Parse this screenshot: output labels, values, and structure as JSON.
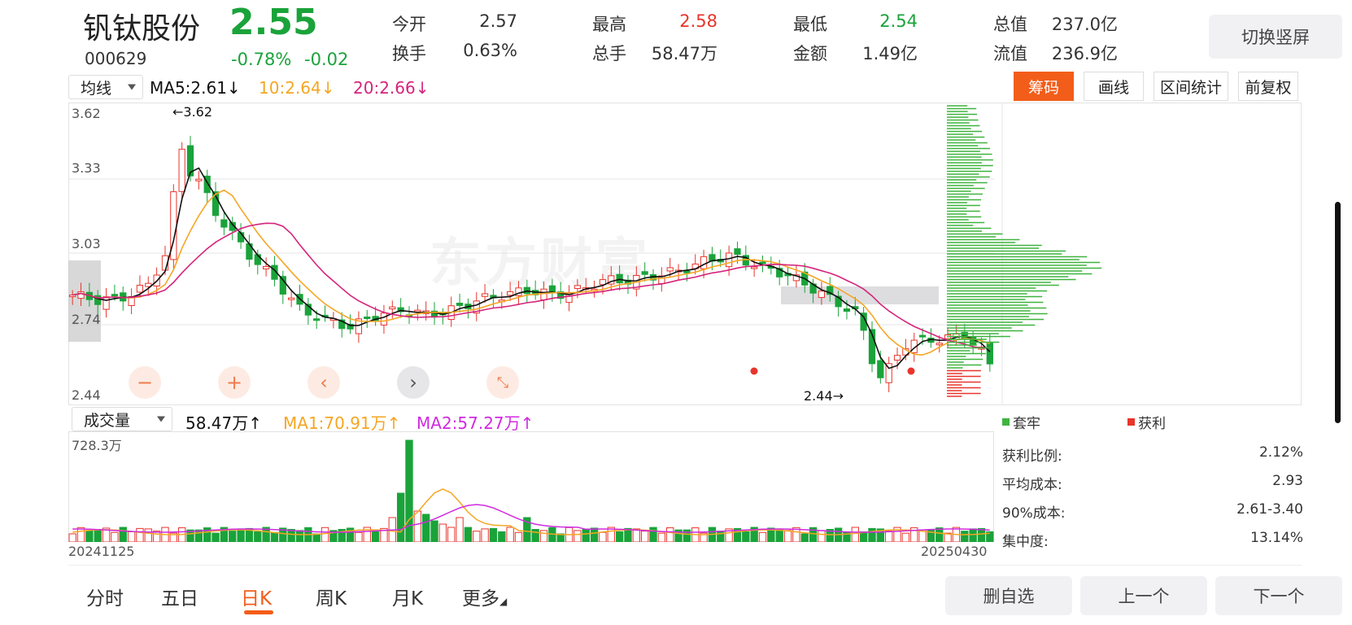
{
  "header": {
    "name": "钒钛股份",
    "code": "000629",
    "price": "2.55",
    "change_pct": "-0.78%",
    "change_abs": "-0.02",
    "quotes": [
      {
        "label": "今开",
        "value": "2.57",
        "color": "#333333"
      },
      {
        "label": "换手",
        "value": "0.63%",
        "color": "#333333"
      },
      {
        "label": "最高",
        "value": "2.58",
        "color": "#e8352c"
      },
      {
        "label": "总手",
        "value": "58.47万",
        "color": "#333333"
      },
      {
        "label": "最低",
        "value": "2.54",
        "color": "#1aa33a"
      },
      {
        "label": "金额",
        "value": "1.49亿",
        "color": "#333333"
      },
      {
        "label": "总值",
        "value": "237.0亿",
        "color": "#333333"
      },
      {
        "label": "流值",
        "value": "236.9亿",
        "color": "#333333"
      }
    ],
    "switch_label": "切换竖屏"
  },
  "toolbar": {
    "indicator_select": "均线",
    "ma5": "MA5:2.61↓",
    "ma10": "10:2.64↓",
    "ma20": "20:2.66↓",
    "buttons": [
      "筹码",
      "画线",
      "区间统计",
      "前复权"
    ],
    "active_button": "筹码"
  },
  "kline": {
    "y_ticks": [
      "3.62",
      "3.33",
      "3.03",
      "2.74",
      "2.44"
    ],
    "high_marker": "←3.62",
    "low_marker": "2.44→",
    "watermark": "东方财富"
  },
  "volume": {
    "indicator_select": "成交量",
    "vol": "58.47万↑",
    "ma1": "MA1:70.91万↑",
    "ma2": "MA2:57.27万↑",
    "max_label": "728.3万",
    "start_date": "20241125",
    "end_date": "20250430"
  },
  "chips": {
    "legend": [
      {
        "label": "套牢",
        "color": "#3fb33f"
      },
      {
        "label": "获利",
        "color": "#e8352c"
      }
    ],
    "stats": [
      {
        "label": "获利比例:",
        "value": "2.12%"
      },
      {
        "label": "平均成本:",
        "value": "2.93"
      },
      {
        "label": "90%成本:",
        "value": "2.61-3.40"
      },
      {
        "label": "集中度:",
        "value": "13.14%"
      }
    ]
  },
  "bottom_nav": {
    "tabs": [
      "分时",
      "五日",
      "日K",
      "周K",
      "月K",
      "更多"
    ],
    "active_tab": "日K",
    "buttons": [
      "删自选",
      "上一个",
      "下一个"
    ]
  },
  "colors": {
    "up": "#e8352c",
    "down": "#1aa33a",
    "ma5": "#111111",
    "ma10": "#f5a623",
    "ma20": "#d6247c",
    "accent": "#f25d1a"
  }
}
